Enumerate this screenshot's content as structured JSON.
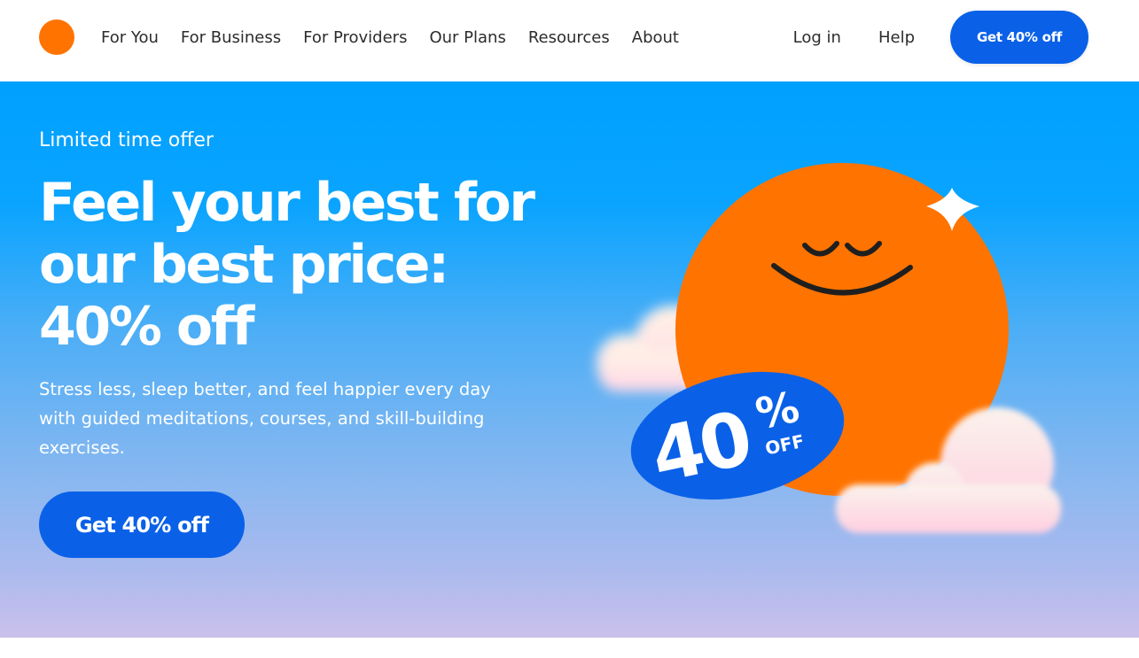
{
  "nav": {
    "links": [
      "For You",
      "For Business",
      "For Providers",
      "Our Plans",
      "Resources",
      "About"
    ],
    "login_label": "Log in",
    "help_label": "Help",
    "cta_label": "Get 40% off"
  },
  "hero": {
    "eyebrow": "Limited time offer",
    "headline": "Feel your best for our best price: 40% off",
    "subtext": "Stress less, sleep better, and feel happier every day with guided meditations, courses, and skill-building exercises.",
    "cta_label": "Get 40% off",
    "badge": {
      "number": "40",
      "percent": "%",
      "word": "OFF"
    }
  },
  "colors": {
    "brand_orange": "#FF7300",
    "cta_blue": "#0A61E8",
    "hero_top": "#00A0FF",
    "hero_bottom": "#CBC0EC",
    "text_dark": "#2D2C2B",
    "white": "#FFFFFF"
  },
  "icons": {
    "logo": "orange-circle-logo",
    "sun": "smiling-sun-illustration",
    "sparkle": "sparkle-star-icon",
    "cloud": "cloud-icon"
  }
}
